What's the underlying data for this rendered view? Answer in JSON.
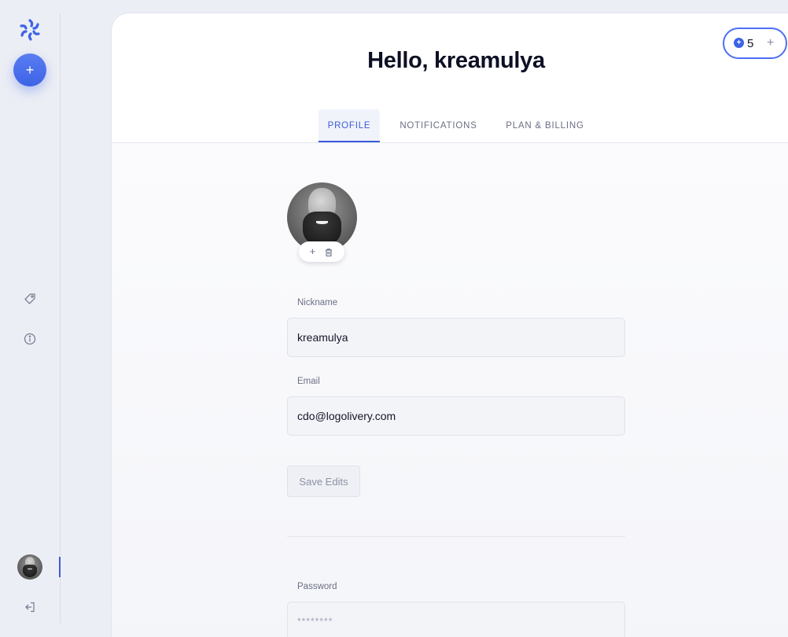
{
  "sidebar": {
    "add_button_label": "+",
    "icons": [
      "tag-icon",
      "info-icon",
      "logout-icon"
    ],
    "accent_color": "#3d63e6"
  },
  "header": {
    "title": "Hello, kreamulya",
    "credits": {
      "coin": "+",
      "count": "5",
      "add_label": "+"
    }
  },
  "tabs": [
    {
      "label": "PROFILE",
      "active": true
    },
    {
      "label": "NOTIFICATIONS",
      "active": false
    },
    {
      "label": "PLAN & BILLING",
      "active": false
    }
  ],
  "profile": {
    "avatar_actions": {
      "add": "+",
      "delete_icon": "trash-icon"
    },
    "nickname": {
      "label": "Nickname",
      "value": "kreamulya"
    },
    "email": {
      "label": "Email",
      "value": "cdo@logolivery.com"
    },
    "save_button": "Save Edits",
    "password": {
      "label": "Password",
      "value": "********"
    }
  }
}
